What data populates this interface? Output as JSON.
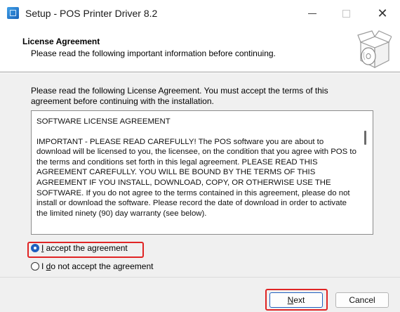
{
  "window": {
    "title": "Setup - POS Printer Driver 8.2",
    "controls": [
      "minimize",
      "maximize",
      "close"
    ]
  },
  "header": {
    "title": "License Agreement",
    "subtitle": "Please read the following important information before continuing."
  },
  "intro": "Please read the following License Agreement. You must accept the terms of this agreement before continuing with the installation.",
  "license": {
    "heading": "SOFTWARE LICENSE AGREEMENT",
    "body": "IMPORTANT - PLEASE READ CAREFULLY!  The POS software you are about to download will be licensed to you, the licensee, on the condition that you agree with POS to the terms and conditions set forth in this legal agreement.  PLEASE READ THIS AGREEMENT CAREFULLY.  YOU WILL BE BOUND BY THE TERMS OF THIS AGREEMENT IF YOU INSTALL, DOWNLOAD, COPY, OR OTHERWISE USE THE SOFTWARE. If you do not agree to the terms contained in this agreement, please do not install or download the software.  Please record the date of download in order to activate the limited ninety (90) day warranty (see below)."
  },
  "options": {
    "accept": {
      "prefix": "",
      "key": "I",
      "rest": " accept the agreement",
      "selected": true
    },
    "decline": {
      "prefix": "I ",
      "key": "d",
      "rest": "o not accept the agreement",
      "selected": false
    }
  },
  "buttons": {
    "next": {
      "key": "N",
      "rest": "ext"
    },
    "cancel": "Cancel"
  },
  "colors": {
    "highlight": "#e02424",
    "accent": "#1f5fbf"
  },
  "icons": {
    "app": "setup-app-icon",
    "header": "software-box-cd-icon"
  }
}
